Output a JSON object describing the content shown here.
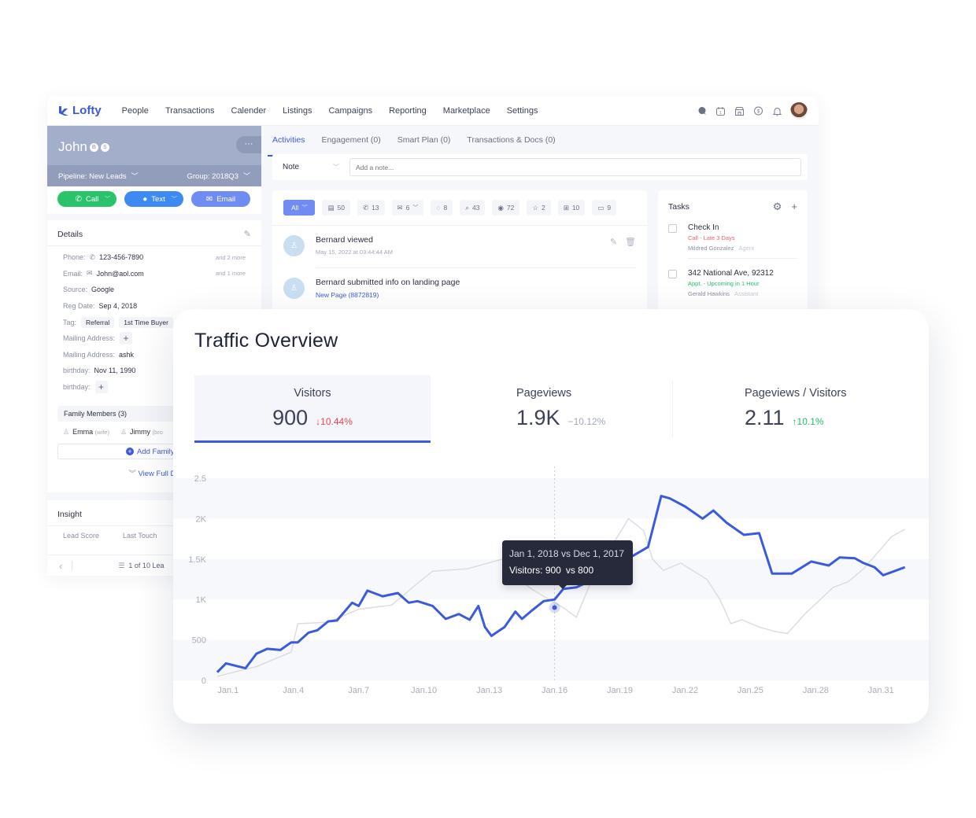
{
  "app": {
    "brand": "Lofty",
    "nav": [
      "People",
      "Transactions",
      "Calender",
      "Listings",
      "Campaigns",
      "Reporting",
      "Marketplace",
      "Settings"
    ],
    "nav_icons": [
      "chat-icon",
      "calendar-icon",
      "store-icon",
      "dollar-icon",
      "bell-icon"
    ]
  },
  "profile": {
    "name": "John",
    "badges": [
      "B",
      "S"
    ],
    "more_label": "···",
    "pipeline": "Pipeline: New Leads",
    "group": "Group: 2018Q3",
    "actions": {
      "call": "Call",
      "text": "Text",
      "email": "Email"
    },
    "details_title": "Details",
    "details": {
      "phone_label": "Phone:",
      "phone": "123-456-7890",
      "phone_more": "and 2 more",
      "email_label": "Email:",
      "email": "John@aol.com",
      "email_more": "and 1 more",
      "source_label": "Source:",
      "source": "Google",
      "reg_label": "Reg Date:",
      "reg": "Sep 4, 2018",
      "tag_label": "Tag:",
      "tags": [
        "Referral",
        "1st Time Buyer"
      ],
      "mail1_label": "Mailing Address:",
      "mail2_label": "Mailing Address:",
      "mail2": "ashk",
      "bday1_label": "birthday:",
      "bday1": "Nov 11, 1990",
      "bday2_label": "birthday:"
    },
    "family_title": "Family Members (3)",
    "family": [
      {
        "name": "Emma",
        "rel": "(wife)"
      },
      {
        "name": "Jimmy",
        "rel": "(bro"
      }
    ],
    "add_family": "Add Family M",
    "view_full": "View Full De",
    "insight_title": "Insight",
    "insight_cols": [
      "Lead Score",
      "Last Touch"
    ],
    "pager": "1 of 10 Lea"
  },
  "activity": {
    "tabs": [
      "Activities",
      "Engagement (0)",
      "Smart Plan (0)",
      "Transactions & Docs (0)"
    ],
    "note_type": "Note",
    "note_placeholder": "Add a note...",
    "filters": [
      {
        "icon": "doc-icon",
        "count": "50"
      },
      {
        "icon": "phone-icon",
        "count": "13"
      },
      {
        "icon": "mail-icon",
        "count": "6"
      },
      {
        "icon": "message-icon",
        "count": "8"
      },
      {
        "icon": "search-icon",
        "count": "43"
      },
      {
        "icon": "eye-icon",
        "count": "72"
      },
      {
        "icon": "star-icon",
        "count": "2"
      },
      {
        "icon": "briefcase-icon",
        "count": "10"
      },
      {
        "icon": "screen-icon",
        "count": "9"
      }
    ],
    "filter_all": "All",
    "feed": [
      {
        "title": "Bernard viewed",
        "sub": "May 15, 2022 at 03:44:44 AM"
      },
      {
        "title": "Bernard submitted info on landing page",
        "link": "New Page (8872819)"
      }
    ]
  },
  "tasks": {
    "title": "Tasks",
    "items": [
      {
        "title": "Check In",
        "status": "Call - Late 3 Days",
        "status_color": "#f0616b",
        "person": "Mildred Gonzalez",
        "role": "Agent"
      },
      {
        "title": "342 National Ave, 92312",
        "status": "Appt. - Upcoming in 1 Hour",
        "status_color": "#1fc16b",
        "person": "Gerald Hawkins",
        "role": "Assistant"
      }
    ]
  },
  "traffic": {
    "title": "Traffic Overview",
    "kpis": [
      {
        "label": "Visitors",
        "value": "900",
        "delta": "10.44%",
        "trend": "down",
        "arrow": "↓"
      },
      {
        "label": "Pageviews",
        "value": "1.9K",
        "delta": "10.12%",
        "trend": "flat",
        "arrow": "−"
      },
      {
        "label": "Pageviews / Visitors",
        "value": "2.11",
        "delta": "10.1%",
        "trend": "up",
        "arrow": "↑"
      }
    ],
    "tooltip": {
      "line1": "Jan 1, 2018 vs Dec 1, 2017",
      "label": "Visitors:",
      "value": "900",
      "compare": "vs 800"
    }
  },
  "chart_data": {
    "type": "line",
    "title": "Traffic Overview",
    "xlabel": "",
    "ylabel": "",
    "ylim": [
      0,
      2500
    ],
    "yticks": [
      0,
      500,
      1000,
      1500,
      2000,
      2500
    ],
    "ytick_labels": [
      "0",
      "500",
      "1K",
      "1.5K",
      "2K",
      "2.5"
    ],
    "xlim": [
      0.5,
      32.4
    ],
    "xticks": [
      1,
      4,
      7,
      10,
      13,
      16,
      19,
      22,
      25,
      28,
      31
    ],
    "xtick_labels": [
      "Jan.1",
      "Jan.4",
      "Jan.7",
      "Jan.10",
      "Jan.13",
      "Jan.16",
      "Jan.19",
      "Jan.22",
      "Jan.25",
      "Jan.28",
      "Jan.31"
    ],
    "grid": "horizontal bands",
    "highlight_x": 16,
    "accent": "#3b5bdb",
    "compare_color": "#dcdde2",
    "series": [
      {
        "name": "Visitors (current)",
        "x": [
          0.5,
          0.9,
          1.8,
          2.3,
          2.8,
          3.4,
          3.9,
          4.2,
          4.7,
          5.1,
          5.6,
          6.0,
          6.7,
          7.0,
          7.4,
          8.1,
          8.8,
          9.3,
          9.7,
          10.4,
          11.0,
          11.6,
          12.1,
          12.5,
          12.8,
          13.1,
          13.7,
          14.2,
          14.5,
          14.9,
          15.5,
          16.0,
          16.4,
          17.0,
          17.4,
          17.9,
          18.6,
          19.0,
          19.6,
          20.3,
          20.9,
          21.3,
          22.0,
          22.8,
          23.3,
          23.9,
          24.7,
          25.4,
          26.0,
          26.9,
          27.8,
          28.6,
          29.1,
          29.8,
          30.2,
          30.7,
          31.1,
          32.1
        ],
        "values": [
          100,
          210,
          150,
          330,
          390,
          375,
          470,
          470,
          590,
          620,
          730,
          740,
          960,
          920,
          1110,
          1040,
          1080,
          960,
          980,
          920,
          760,
          820,
          750,
          920,
          660,
          550,
          660,
          850,
          760,
          850,
          980,
          1000,
          1130,
          1150,
          1200,
          1500,
          1470,
          1570,
          1540,
          1650,
          2280,
          2250,
          2150,
          2000,
          2100,
          1950,
          1800,
          1820,
          1320,
          1320,
          1470,
          1420,
          1520,
          1510,
          1450,
          1400,
          1300,
          1400
        ]
      },
      {
        "name": "Visitors (previous)",
        "x": [
          0.5,
          2.3,
          3.9,
          4.2,
          5.6,
          7.0,
          8.5,
          9.8,
          10.4,
          12.0,
          13.6,
          14.6,
          15.0,
          16.4,
          17.0,
          17.8,
          19.4,
          20.1,
          20.5,
          21.0,
          21.8,
          23.0,
          23.6,
          24.1,
          24.6,
          25.4,
          26.2,
          26.7,
          27.5,
          28.8,
          29.5,
          30.2,
          31.5,
          32.1
        ],
        "values": [
          50,
          170,
          350,
          700,
          720,
          880,
          930,
          1220,
          1350,
          1380,
          1500,
          1200,
          1120,
          900,
          780,
          1300,
          2000,
          1850,
          1500,
          1360,
          1450,
          1250,
          1000,
          700,
          750,
          660,
          600,
          580,
          820,
          1150,
          1220,
          1380,
          1780,
          1870
        ]
      }
    ]
  }
}
